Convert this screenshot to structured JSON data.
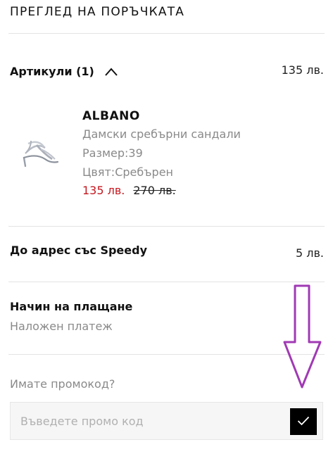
{
  "section_title": "ПРЕГЛЕД НА ПОРЪЧКАТА",
  "items": {
    "label": "Артикули (1)",
    "total": "135 лв.",
    "expanded_icon": "chevron-up-icon",
    "product": {
      "brand": "ALBANO",
      "name": "Дамски сребърни сандали",
      "size_label": "Размер:",
      "size_value": "39",
      "color_label": "Цвят:",
      "color_value": "Сребърен",
      "price_new": "135 лв.",
      "price_old": "270 лв.",
      "image_icon": "silver-sandal-image"
    }
  },
  "delivery": {
    "label": "До адрес със Speedy",
    "price": "5 лв."
  },
  "payment": {
    "title": "Начин на плащане",
    "method": "Наложен платеж"
  },
  "promo": {
    "question": "Имате промокод?",
    "placeholder": "Въведете промо код",
    "value": "",
    "submit_icon": "checkmark-icon"
  },
  "annotation": {
    "icon": "down-arrow-annotation-icon",
    "color": "#a03ab4"
  },
  "colors": {
    "sale_price": "#c4181f",
    "muted_text": "#8a8a8a",
    "submit_bg": "#000000"
  }
}
